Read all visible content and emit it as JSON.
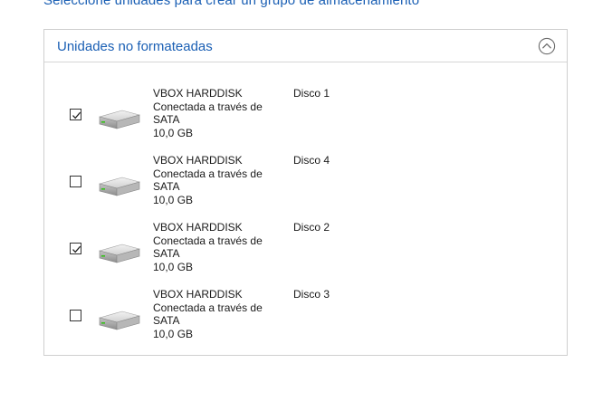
{
  "page": {
    "heading": "Seleccione unidades para crear un grupo de almacenamiento"
  },
  "group": {
    "title": "Unidades no formateadas",
    "collapse_icon": "chevron-up-circle-icon",
    "accent_color": "#1a5fb4"
  },
  "disks": [
    {
      "checked": true,
      "name": "VBOX HARDDISK",
      "connection_line1": "Conectada a través de",
      "connection_line2": "SATA",
      "size": "10,0 GB",
      "label": "Disco 1",
      "icon": "hard-drive-icon"
    },
    {
      "checked": false,
      "name": "VBOX HARDDISK",
      "connection_line1": "Conectada a través de",
      "connection_line2": "SATA",
      "size": "10,0 GB",
      "label": "Disco 4",
      "icon": "hard-drive-icon"
    },
    {
      "checked": true,
      "name": "VBOX HARDDISK",
      "connection_line1": "Conectada a través de",
      "connection_line2": "SATA",
      "size": "10,0 GB",
      "label": "Disco 2",
      "icon": "hard-drive-icon"
    },
    {
      "checked": false,
      "name": "VBOX HARDDISK",
      "connection_line1": "Conectada a través de",
      "connection_line2": "SATA",
      "size": "10,0 GB",
      "label": "Disco 3",
      "icon": "hard-drive-icon"
    }
  ]
}
